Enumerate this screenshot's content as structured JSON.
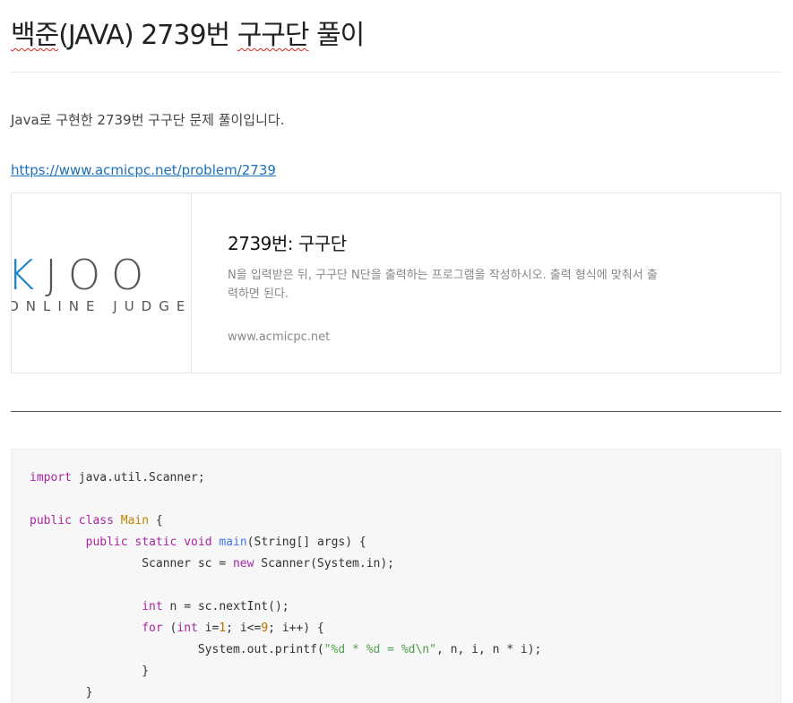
{
  "post": {
    "title_prefix": "백준",
    "title_middle": "(JAVA) 2739번 ",
    "title_squiggle": "구구단",
    "title_suffix": " 풀이",
    "intro": "Java로 구현한 2739번 구구단 문제 풀이입니다.",
    "link": "https://www.acmicpc.net/problem/2739"
  },
  "og_card": {
    "logo_big": "EKJOO",
    "logo_small": "ONLINE JUDGE",
    "title": "2739번: 구구단",
    "description": "N을 입력받은 뒤, 구구단 N단을 출력하는 프로그램을 작성하시오. 출력 형식에 맞춰서 출력하면 된다.",
    "host": "www.acmicpc.net",
    "colors": {
      "logo_accent": "#1d82c4",
      "logo_text": "#555555"
    }
  },
  "code": {
    "lines": [
      [
        [
          "kw",
          "import"
        ],
        [
          "pl",
          " java.util.Scanner;"
        ]
      ],
      [],
      [
        [
          "kw",
          "public"
        ],
        [
          "pl",
          " "
        ],
        [
          "kw",
          "class"
        ],
        [
          "pl",
          " "
        ],
        [
          "cls",
          "Main"
        ],
        [
          "pl",
          " {"
        ]
      ],
      [
        [
          "pl",
          "        "
        ],
        [
          "kw",
          "public"
        ],
        [
          "pl",
          " "
        ],
        [
          "kw",
          "static"
        ],
        [
          "pl",
          " "
        ],
        [
          "kw",
          "void"
        ],
        [
          "pl",
          " "
        ],
        [
          "fn",
          "main"
        ],
        [
          "pl",
          "(String[] args) {"
        ]
      ],
      [
        [
          "pl",
          "                Scanner sc = "
        ],
        [
          "kw",
          "new"
        ],
        [
          "pl",
          " Scanner(System.in);"
        ]
      ],
      [],
      [
        [
          "pl",
          "                "
        ],
        [
          "kw",
          "int"
        ],
        [
          "pl",
          " n = sc.nextInt();"
        ]
      ],
      [
        [
          "pl",
          "                "
        ],
        [
          "kw",
          "for"
        ],
        [
          "pl",
          " ("
        ],
        [
          "kw",
          "int"
        ],
        [
          "pl",
          " i="
        ],
        [
          "num",
          "1"
        ],
        [
          "pl",
          "; i<="
        ],
        [
          "num",
          "9"
        ],
        [
          "pl",
          "; i++) {"
        ]
      ],
      [
        [
          "pl",
          "                        System.out.printf("
        ],
        [
          "str",
          "\"%d * %d = %d\\n\""
        ],
        [
          "pl",
          ", n, i, n * i);"
        ]
      ],
      [
        [
          "pl",
          "                }"
        ]
      ],
      [
        [
          "pl",
          "        }"
        ]
      ],
      [
        [
          "pl",
          "}"
        ]
      ]
    ]
  }
}
